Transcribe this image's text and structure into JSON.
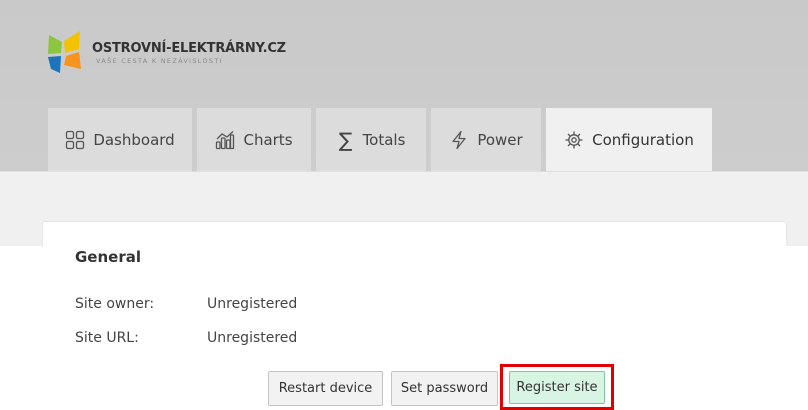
{
  "brand": {
    "name": "OSTROVNÍ-ELEKTRÁRNY.CZ",
    "tagline": "VAŠE CESTA K NEZÁVISLOSTI",
    "colors": {
      "yellow": "#f2c200",
      "green": "#8cc63f",
      "blue": "#1b75bc",
      "orange": "#f7941d"
    }
  },
  "tabs": [
    {
      "id": "dashboard",
      "label": "Dashboard",
      "icon": "grid-icon",
      "active": false
    },
    {
      "id": "charts",
      "label": "Charts",
      "icon": "bar-chart-icon",
      "active": false
    },
    {
      "id": "totals",
      "label": "Totals",
      "icon": "sigma-icon",
      "active": false
    },
    {
      "id": "power",
      "label": "Power",
      "icon": "lightning-icon",
      "active": false
    },
    {
      "id": "configuration",
      "label": "Configuration",
      "icon": "gear-icon",
      "active": true
    }
  ],
  "general": {
    "title": "General",
    "site_owner_label": "Site owner:",
    "site_owner_value": "Unregistered",
    "site_url_label": "Site URL:",
    "site_url_value": "Unregistered"
  },
  "buttons": {
    "restart": "Restart device",
    "set_password": "Set password",
    "register": "Register site"
  },
  "highlight_color": "#e00000"
}
